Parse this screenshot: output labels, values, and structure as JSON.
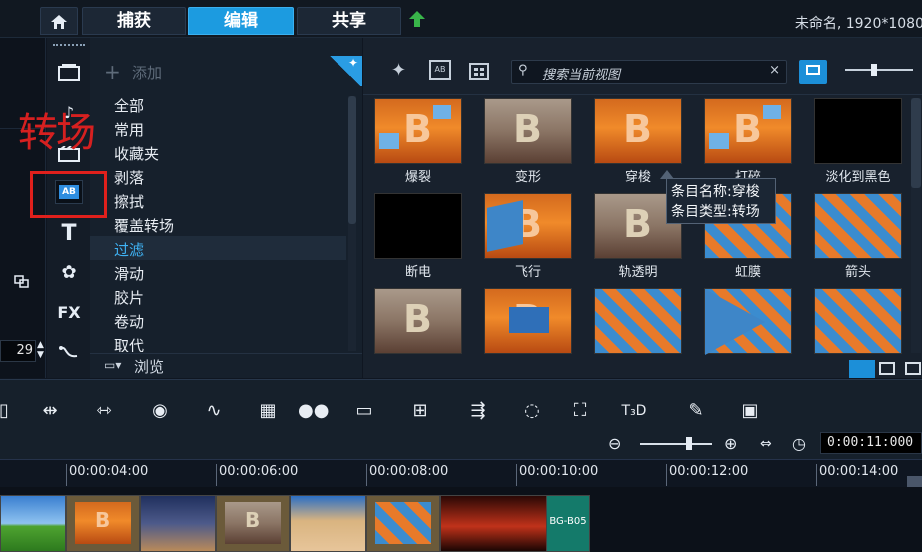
{
  "header": {
    "tabs": [
      {
        "label": "捕获",
        "active": false
      },
      {
        "label": "编辑",
        "active": true
      },
      {
        "label": "共享",
        "active": false
      }
    ],
    "project_title": "未命名, 1920*1080"
  },
  "annotation": {
    "text": "转场",
    "color": "#d62020"
  },
  "left_strip": {
    "spin_value": "29"
  },
  "category_panel": {
    "add_label": "添加",
    "items": [
      "全部",
      "常用",
      "收藏夹",
      "剥落",
      "擦拭",
      "覆盖转场",
      "过滤",
      "滑动",
      "胶片",
      "卷动",
      "取代"
    ],
    "selected": "过滤",
    "browse_label": "浏览"
  },
  "library": {
    "search_placeholder": "搜索当前视图",
    "search_clear": "×",
    "items": [
      {
        "label": "爆裂",
        "style": "orange-tiles"
      },
      {
        "label": "变形",
        "style": "desert"
      },
      {
        "label": "穿梭",
        "style": "orange"
      },
      {
        "label": "打碎",
        "style": "orange-tiles"
      },
      {
        "label": "淡化到黑色",
        "style": "black"
      },
      {
        "label": "断电",
        "style": "black"
      },
      {
        "label": "飞行",
        "style": "orange-fly"
      },
      {
        "label": "轨透明",
        "style": "desert"
      },
      {
        "label": "虹膜",
        "style": "tiles"
      },
      {
        "label": "箭头",
        "style": "tiles"
      },
      {
        "label": "",
        "style": "desert"
      },
      {
        "label": "",
        "style": "orange-blue"
      },
      {
        "label": "",
        "style": "tiles"
      },
      {
        "label": "",
        "style": "tiles-blue"
      },
      {
        "label": "",
        "style": "tiles"
      }
    ],
    "tooltip": {
      "line1": "条目名称:穿梭",
      "line2": "条目类型:转场"
    }
  },
  "timeline": {
    "timecode": "0:00:11:000",
    "ruler": [
      "00:00:04:00",
      "00:00:06:00",
      "00:00:08:00",
      "00:00:10:00",
      "00:00:12:00",
      "00:00:14:00"
    ],
    "last_clip_label": "BG-B05"
  },
  "colors": {
    "accent": "#1c9be0",
    "selected_text": "#3fb3f5"
  }
}
